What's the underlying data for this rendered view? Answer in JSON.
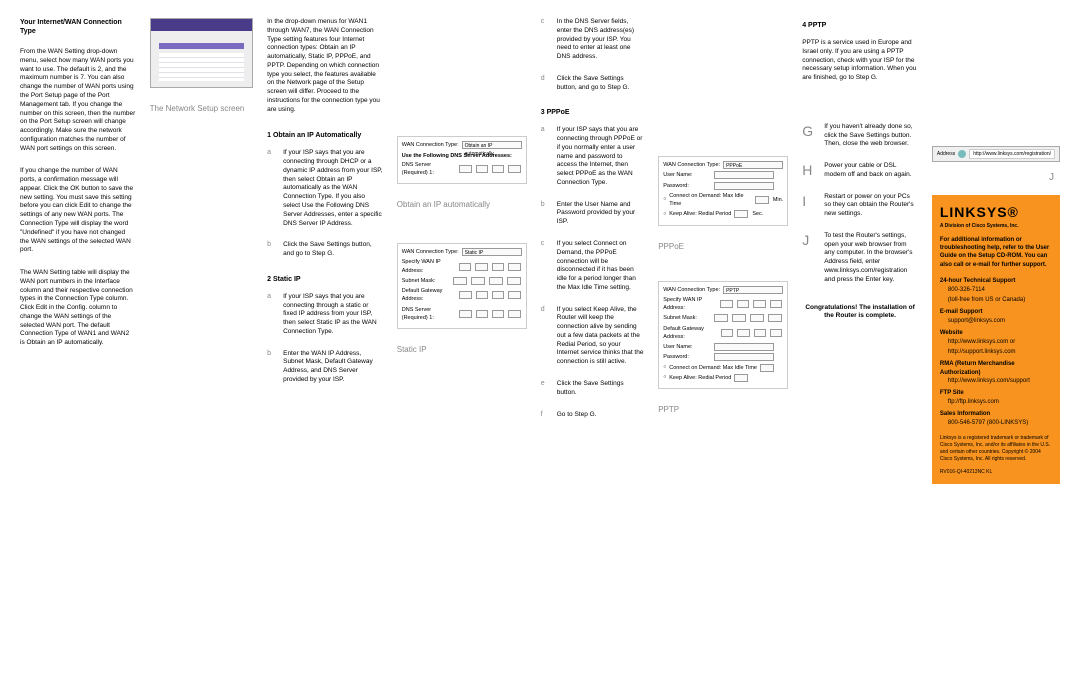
{
  "col1": {
    "heading": "Your Internet/WAN Connection Type",
    "p1": "From the WAN Setting drop-down menu, select how many WAN ports you want to use. The default is 2, and the maximum number is 7. You can also change the number of WAN ports using the Port Setup page of the Port Management tab. If you change the number on this screen, then the number on the Port Setup screen will change accordingly. Make sure the network configuration matches the number of WAN port settings on this screen.",
    "p2": "If you change the number of WAN ports, a confirmation message will appear. Click the OK button to save the new setting. You must save this setting before you can click Edit to change the settings of any new WAN ports. The Connection Type will display the word \"Undefined\" if you have not changed the WAN settings of the selected WAN port.",
    "p3": "The WAN Setting table will display the WAN port numbers in the Interface column and their respective connection types in the Connection Type column. Click Edit in the Config. column to change the WAN settings of the selected WAN port. The default Connection Type of WAN1 and WAN2 is Obtain an IP automatically."
  },
  "col2": {
    "caption1": "The Network Setup screen"
  },
  "col3": {
    "intro": "In the drop-down menus for WAN1 through WAN7, the WAN Connection Type setting features four Internet connection types: Obtain an IP automatically, Static IP, PPPoE, and PPTP. Depending on which connection type you select, the features available on the Network page of the Setup screen will differ. Proceed to the instructions for the connection type you are using.",
    "h1": "1  Obtain an IP Automatically",
    "a_text": "If your ISP says that you are connecting through DHCP or a dynamic IP address from your ISP, then select Obtain an IP automatically as the WAN Connection Type. If you also select Use the Following DNS Server Addresses, enter a specific DNS Server IP Address.",
    "b_text": "Click the Save Settings button, and go to Step G.",
    "h2": "2  Static IP",
    "a2_text": "If your ISP says that you are connecting through a static or fixed IP address from your ISP, then select Static IP as the WAN Connection Type.",
    "b2_text": "Enter the WAN IP Address, Subnet Mask, Default Gateway Address, and DNS Server provided by your ISP."
  },
  "col4": {
    "form1": {
      "wan": "WAN Connection Type:",
      "opt": "Obtain an IP automatically",
      "dns_head": "Use the Following DNS Server Addresses:",
      "dns_lab": "DNS Server (Required) 1:"
    },
    "caption1": "Obtain an IP automatically",
    "form2": {
      "wan": "WAN Connection Type:",
      "opt": "Static IP",
      "ip_lab": "Specify WAN IP Address:",
      "sm_lab": "Subnet Mask:",
      "gw_lab": "Default Gateway Address:",
      "dns_lab": "DNS Server (Required) 1:"
    },
    "caption2": "Static IP"
  },
  "col5": {
    "c_text": "In the DNS Server fields, enter the DNS address(es) provided by your ISP. You need to enter at least one DNS address.",
    "d_text": "Click the Save Settings button, and go to Step G.",
    "h3": "3  PPPoE",
    "a_text": "If your ISP says that you are connecting through PPPoE or if you normally enter a user name and password to access the Internet, then select PPPoE as the WAN Connection Type.",
    "b_text": "Enter the User Name and Password provided by your ISP.",
    "c2_text": "If you select Connect on Demand, the PPPoE connection will be disconnected if it has been idle for a period longer than the Max Idle Time setting.",
    "d2_text": "If you select Keep Alive, the Router will keep the connection alive by sending out a few data packets at the Redial Period, so your Internet service thinks that the connection is still active.",
    "e_text": "Click the Save Settings button.",
    "f_text": "Go to Step G."
  },
  "col6": {
    "form3": {
      "wan": "WAN Connection Type:",
      "opt": "PPPoE",
      "user": "User Name:",
      "pass": "Password:",
      "cod": "Connect on Demand: Max Idle Time",
      "ka": "Keep Alive: Redial Period",
      "min": "Min.",
      "sec": "Sec."
    },
    "caption1": "PPPoE",
    "form4": {
      "wan": "WAN Connection Type:",
      "opt": "PPTP",
      "ip_lab": "Specify WAN IP Address:",
      "sm_lab": "Subnet Mask:",
      "gw_lab": "Default Gateway Address:",
      "user": "User Name:",
      "pass": "Password:",
      "cod": "Connect on Demand: Max Idle Time",
      "ka": "Keep Alive: Redial Period"
    },
    "caption2": "PPTP"
  },
  "col7": {
    "h4": "4  PPTP",
    "intro": "PPTP is a service used in Europe and Israel only. If you are using a PPTP connection, check with your ISP for the necessary setup information. When you are finished, go to Step G.",
    "G": "If you haven't already done so, click the Save Settings button. Then, close the web browser.",
    "H": "Power your cable or DSL modem off and back on again.",
    "I": "Restart or power on your PCs so they can obtain the Router's new settings.",
    "J": "To test the Router's settings, open your web browser from any computer. In the browser's Address field, enter www.linksys.com/registration and press the Enter key.",
    "congrats": "Congratulations! The installation of the Router is complete."
  },
  "col8": {
    "addr_label": "Address",
    "url": "http://www.linksys.com/registration/",
    "j": "J",
    "logo": "LINKSYS®",
    "tag": "A Division of Cisco Systems, Inc.",
    "intro": "For additional information or troubleshooting help, refer to the User Guide on the Setup CD-ROM. You can also call or e-mail for further support.",
    "ts_label": "24-hour Technical Support",
    "ts_val": "800-326-7114",
    "ts_note": "(toll-free from US or Canada)",
    "email_label": "E-mail Support",
    "email_val": "support@linksys.com",
    "web_label": "Website",
    "web_val1": "http://www.linksys.com or",
    "web_val2": "http://support.linksys.com",
    "rma_label": "RMA (Return Merchandise Authorization)",
    "rma_val": "http://www.linksys.com/support",
    "ftp_label": "FTP Site",
    "ftp_val": "ftp://ftp.linksys.com",
    "sales_label": "Sales Information",
    "sales_val": "800-546-5797 (800-LINKSYS)",
    "legal": "Linksys is a registered trademark or trademark of Cisco Systems, Inc. and/or its affiliates in the U.S. and certain other countries. Copyright © 2004 Cisco Systems, Inc. All rights reserved.",
    "pn": "RV016-QI-40213NC KL"
  }
}
